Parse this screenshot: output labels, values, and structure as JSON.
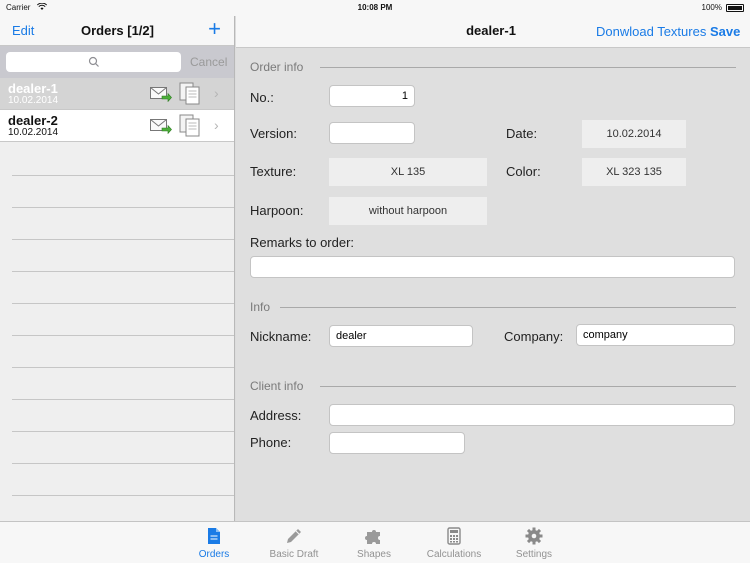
{
  "status_bar": {
    "carrier": "Carrier",
    "time": "10:08 PM",
    "battery": "100%"
  },
  "orders_pane": {
    "edit_label": "Edit",
    "title": "Orders [1/2]",
    "add_icon": "plus-icon",
    "search_placeholder": "",
    "cancel_label": "Cancel",
    "orders": [
      {
        "name": "dealer-1",
        "date": "10.02.2014",
        "selected": true
      },
      {
        "name": "dealer-2",
        "date": "10.02.2014",
        "selected": false
      }
    ]
  },
  "detail": {
    "title": "dealer-1",
    "download_label": "Donwload Textures",
    "save_label": "Save",
    "order_info": {
      "section_title": "Order info",
      "no_label": "No.:",
      "no_value": "1",
      "version_label": "Version:",
      "version_value": "",
      "date_label": "Date:",
      "date_value": "10.02.2014",
      "texture_label": "Texture:",
      "texture_value": "XL 135",
      "color_label": "Color:",
      "color_value": "XL 323 135",
      "harpoon_label": "Harpoon:",
      "harpoon_value": "without harpoon",
      "remarks_label": "Remarks to order:",
      "remarks_value": ""
    },
    "info": {
      "section_title": "Info",
      "nickname_label": "Nickname:",
      "nickname_value": "dealer",
      "company_label": "Company:",
      "company_value": "company"
    },
    "client_info": {
      "section_title": "Client info",
      "address_label": "Address:",
      "address_value": "",
      "phone_label": "Phone:",
      "phone_value": ""
    }
  },
  "tabs": [
    {
      "label": "Orders",
      "icon": "document-icon",
      "active": true
    },
    {
      "label": "Basic Draft",
      "icon": "pencil-icon",
      "active": false
    },
    {
      "label": "Shapes",
      "icon": "puzzle-icon",
      "active": false
    },
    {
      "label": "Calculations",
      "icon": "calculator-icon",
      "active": false
    },
    {
      "label": "Settings",
      "icon": "gear-icon",
      "active": false
    }
  ],
  "colors": {
    "accent": "#1a7be6",
    "selected_row": "#d4d4d4",
    "background": "#dfdfdf"
  }
}
